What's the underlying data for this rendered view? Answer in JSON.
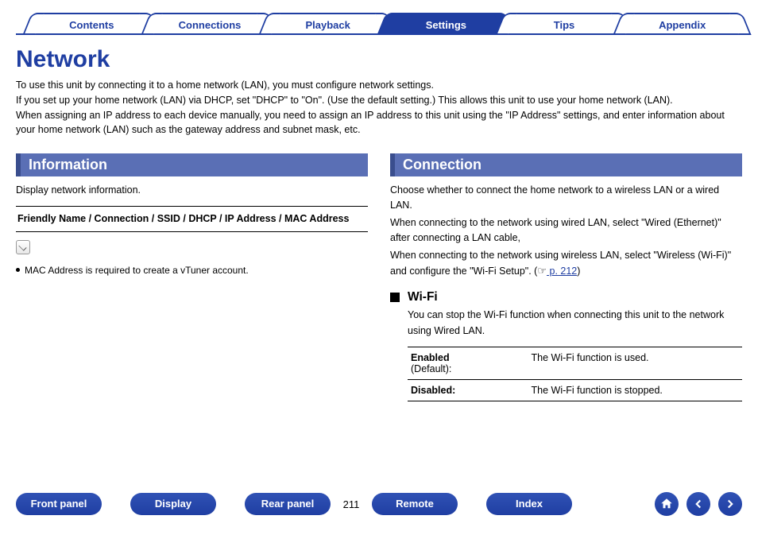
{
  "tabs": {
    "contents": "Contents",
    "connections": "Connections",
    "playback": "Playback",
    "settings": "Settings",
    "tips": "Tips",
    "appendix": "Appendix",
    "active": "Settings"
  },
  "title": "Network",
  "intro": "To use this unit by connecting it to a home network (LAN), you must configure network settings.\nIf you set up your home network (LAN) via DHCP, set \"DHCP\" to \"On\". (Use the default setting.) This allows this unit to use your home network (LAN).\nWhen assigning an IP address to each device manually, you need to assign an IP address to this unit using the \"IP Address\" settings, and enter information about your home network (LAN) such as the gateway address and subnet mask, etc.",
  "left": {
    "head": "Information",
    "lede": "Display network information.",
    "boxed": "Friendly Name / Connection / SSID / DHCP / IP Address / MAC Address",
    "bullet1": "MAC Address is required to create a vTuner account."
  },
  "right": {
    "head": "Connection",
    "p1": "Choose whether to connect the home network to a wireless LAN or a wired LAN.",
    "p2": "When connecting to the network using wired LAN, select \"Wired (Ethernet)\" after connecting a LAN cable,",
    "p3_a": "When connecting to the network using wireless LAN, select \"Wireless (Wi-Fi)\" and configure the \"Wi-Fi Setup\". (",
    "p3_link": " p. 212",
    "p3_b": ")",
    "wifi_head": "Wi-Fi",
    "wifi_lede": "You can stop the Wi-Fi function when connecting this unit to the network using Wired LAN.",
    "rows": [
      {
        "k_main": "Enabled",
        "k_sub": "(Default):",
        "v": "The Wi-Fi function is used."
      },
      {
        "k_main": "Disabled:",
        "k_sub": "",
        "v": "The Wi-Fi function is stopped."
      }
    ]
  },
  "bottom": {
    "front_panel": "Front panel",
    "display": "Display",
    "rear_panel": "Rear panel",
    "page": "211",
    "remote": "Remote",
    "index": "Index"
  }
}
